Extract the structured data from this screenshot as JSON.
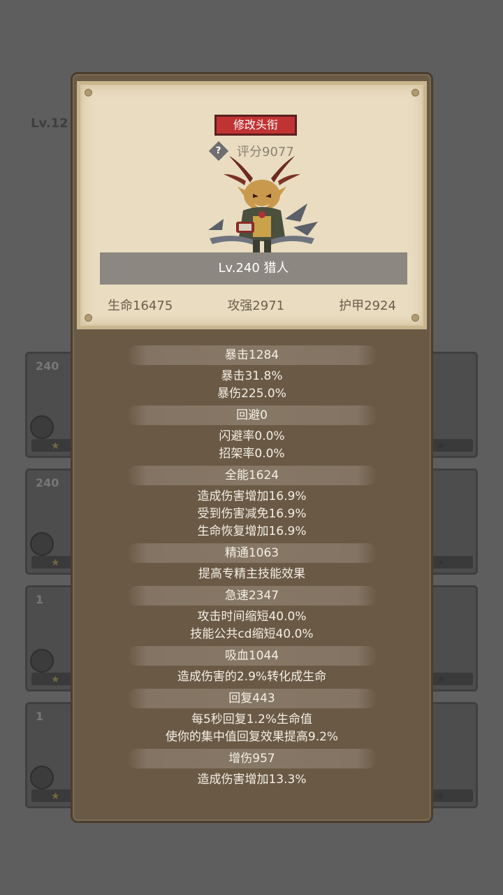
{
  "background": {
    "player_level": "Lv.12",
    "card_levels": [
      "240",
      "240",
      "1",
      "1"
    ]
  },
  "dialog": {
    "title_button": "修改头衔",
    "score": "评分9077",
    "hero_name": "Lv.240 猎人",
    "basic_stats": [
      "生命16475",
      "攻强2971",
      "护甲2924"
    ]
  },
  "stats": [
    {
      "header": "暴击1284",
      "lines": [
        "暴击31.8%",
        "暴伤225.0%"
      ]
    },
    {
      "header": "回避0",
      "lines": [
        "闪避率0.0%",
        "招架率0.0%"
      ]
    },
    {
      "header": "全能1624",
      "lines": [
        "造成伤害增加16.9%",
        "受到伤害减免16.9%",
        "生命恢复增加16.9%"
      ]
    },
    {
      "header": "精通1063",
      "lines": [
        "提高专精主技能效果"
      ]
    },
    {
      "header": "急速2347",
      "lines": [
        "攻击时间缩短40.0%",
        "技能公共cd缩短40.0%"
      ]
    },
    {
      "header": "吸血1044",
      "lines": [
        "造成伤害的2.9%转化成生命"
      ]
    },
    {
      "header": "回复443",
      "lines": [
        "每5秒回复1.2%生命值",
        "使你的集中值回复效果提高9.2%"
      ]
    },
    {
      "header": "增伤957",
      "lines": [
        "造成伤害增加13.3%"
      ]
    }
  ]
}
